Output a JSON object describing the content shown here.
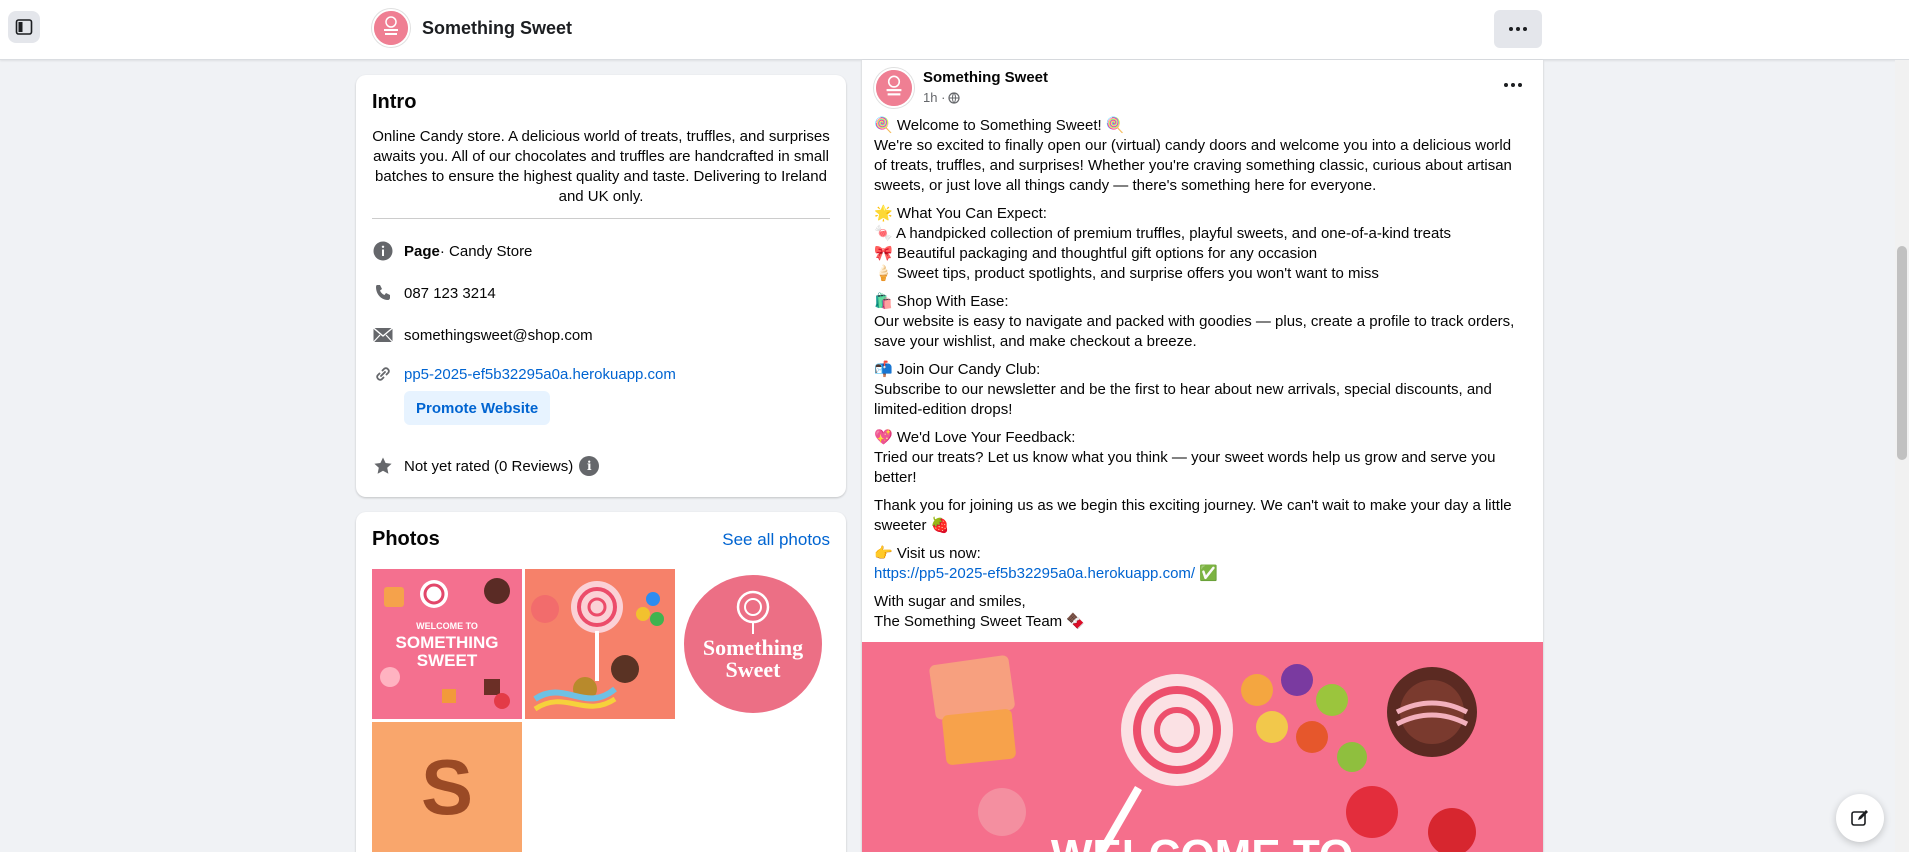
{
  "header": {
    "page_name": "Something Sweet"
  },
  "intro": {
    "title": "Intro",
    "bio": "Online Candy store. A delicious world of treats, truffles, and surprises awaits you. All of our chocolates and truffles are handcrafted in small batches to ensure the highest quality and taste. Delivering to Ireland and UK only.",
    "category_label": "Page",
    "category_value": " · Candy Store",
    "phone": "087 123 3214",
    "email": "somethingsweet@shop.com",
    "website": "pp5-2025-ef5b32295a0a.herokuapp.com",
    "promote_label": "Promote Website",
    "rating": "Not yet rated (0 Reviews)"
  },
  "photos": {
    "title": "Photos",
    "see_all": "See all photos",
    "tile1_line1": "WELCOME TO",
    "tile1_line2": "SOMETHING",
    "tile1_line3": "SWEET",
    "tile3_line1": "Something",
    "tile3_line2": "Sweet",
    "tile4_letter": "S"
  },
  "post": {
    "author": "Something Sweet",
    "time": "1h ·",
    "p1_title": "🍭 Welcome to Something Sweet! 🍭",
    "p1_body": "We're so excited to finally open our (virtual) candy doors and welcome you into a delicious world of treats, truffles, and surprises! Whether you're craving something classic, curious about artisan sweets, or just love all things candy — there's something here for everyone.",
    "p2_title": "🌟 What You Can Expect:",
    "p2_l1": "🍬 A handpicked collection of premium truffles, playful sweets, and one-of-a-kind treats",
    "p2_l2": "🎀 Beautiful packaging and thoughtful gift options for any occasion",
    "p2_l3": "🍦 Sweet tips, product spotlights, and surprise offers you won't want to miss",
    "p3_title": "🛍️ Shop With Ease:",
    "p3_body": "Our website is easy to navigate and packed with goodies — plus, create a profile to track orders, save your wishlist, and make checkout a breeze.",
    "p4_title": "📬 Join Our Candy Club:",
    "p4_body": "Subscribe to our newsletter and be the first to hear about new arrivals, special discounts, and limited-edition drops!",
    "p5_title": "💖 We'd Love Your Feedback:",
    "p5_body": "Tried our treats? Let us know what you think — your sweet words help us grow and serve you better!",
    "p6_body": "Thank you for joining us as we begin this exciting journey. We can't wait to make your day a little sweeter 🍓",
    "p7_title": "👉 Visit us now:",
    "p7_link": "https://pp5-2025-ef5b32295a0a.herokuapp.com/",
    "p7_check": "✅",
    "p8_l1": "With sugar and smiles,",
    "p8_l2": "The Something Sweet Team 🍫",
    "image_text": "WELCOME TO"
  },
  "colors": {
    "accent": "#0064d1",
    "brand_pink": "#f07d92",
    "promote_bg": "#e7f3ff"
  },
  "icons": [
    "sidebar-toggle-icon",
    "more-icon",
    "info-icon",
    "phone-icon",
    "mail-icon",
    "link-icon",
    "star-icon",
    "globe-icon",
    "compose-icon"
  ]
}
